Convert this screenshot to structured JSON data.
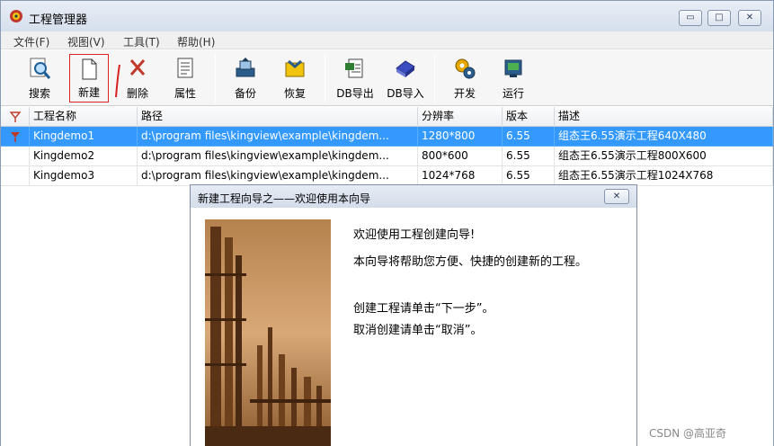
{
  "window": {
    "title": "工程管理器",
    "minimize": "▭",
    "maximize": "□",
    "close": "✕"
  },
  "menu": [
    "文件(F)",
    "视图(V)",
    "工具(T)",
    "帮助(H)"
  ],
  "toolbar": {
    "search": "搜索",
    "new": "新建",
    "delete": "删除",
    "properties": "属性",
    "backup": "备份",
    "restore": "恢复",
    "db_export": "DB导出",
    "db_import": "DB导入",
    "develop": "开发",
    "run": "运行"
  },
  "table": {
    "columns": [
      "工程名称",
      "路径",
      "分辨率",
      "版本",
      "描述"
    ],
    "rows": [
      [
        "Kingdemo1",
        "d:\\program files\\kingview\\example\\kingdem...",
        "1280*800",
        "6.55",
        "组态王6.55演示工程640X480"
      ],
      [
        "Kingdemo2",
        "d:\\program files\\kingview\\example\\kingdem...",
        "800*600",
        "6.55",
        "组态王6.55演示工程800X600"
      ],
      [
        "Kingdemo3",
        "d:\\program files\\kingview\\example\\kingdem...",
        "1024*768",
        "6.55",
        "组态王6.55演示工程1024X768"
      ]
    ],
    "selected_row": 0
  },
  "dialog": {
    "title": "新建工程向导之——欢迎使用本向导",
    "close": "✕",
    "lines": [
      "欢迎使用工程创建向导!",
      "本向导将帮助您方便、快捷的创建新的工程。",
      "创建工程请单击“下一步”。",
      "取消创建请单击“取消”。"
    ]
  },
  "watermark": "CSDN @高亚奇",
  "colors": {
    "selection": "#3399ff",
    "accent_red": "#d22222"
  }
}
